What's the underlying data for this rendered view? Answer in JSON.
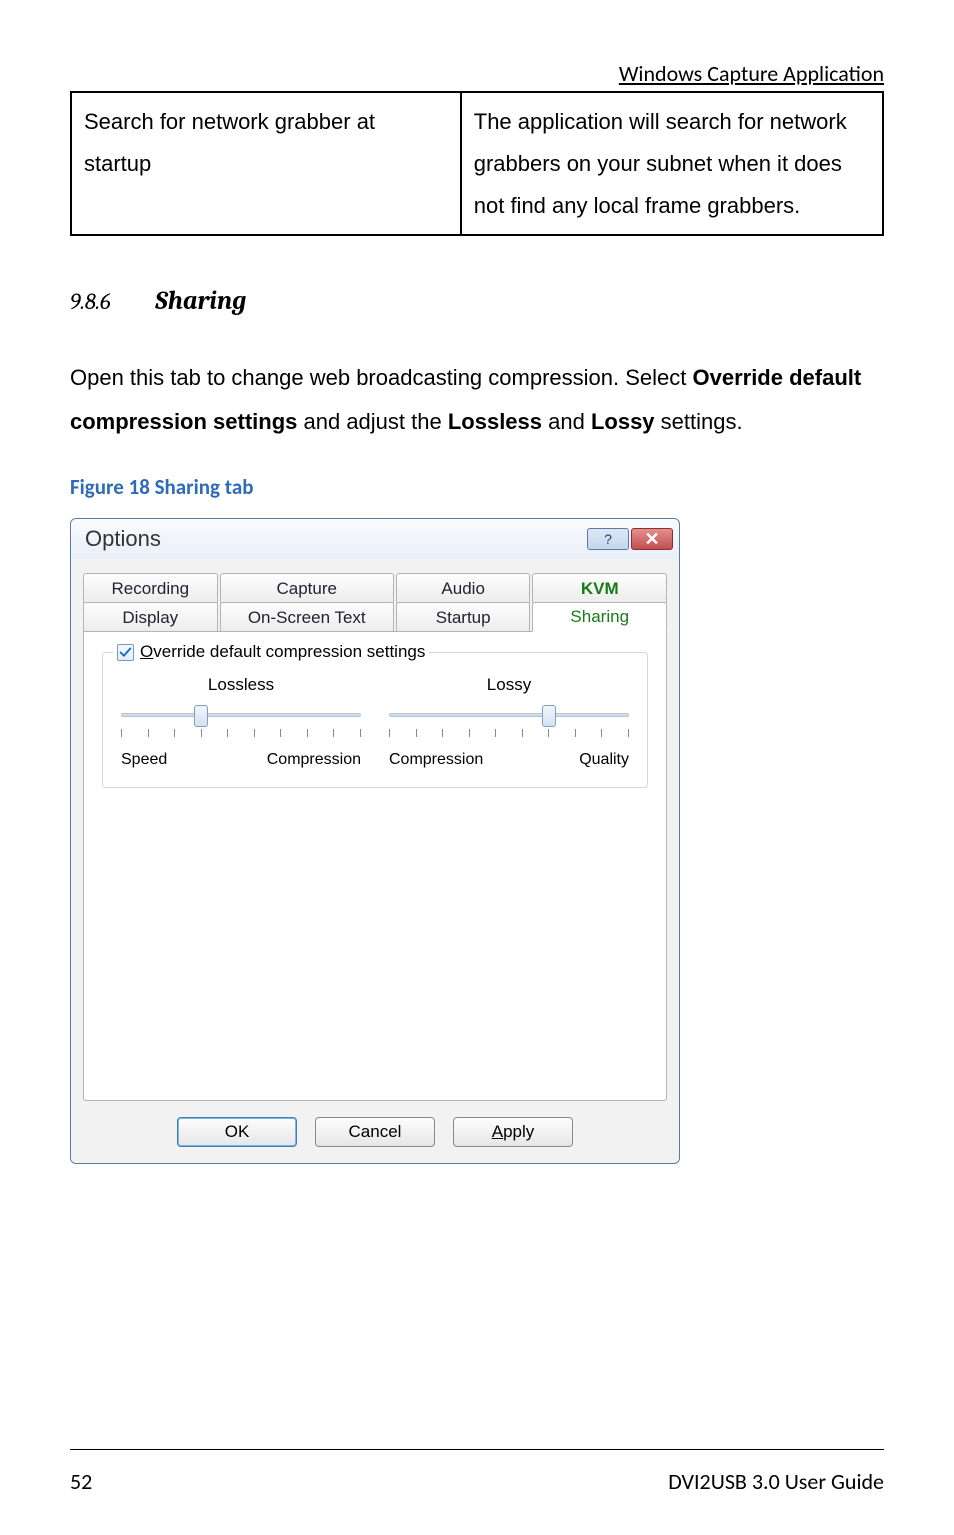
{
  "header": {
    "text": "Windows Capture Application"
  },
  "table": {
    "cell_left": "Search for network grabber at startup",
    "cell_right": "The application will search for network grabbers on your subnet when it does not find any local frame grabbers."
  },
  "section": {
    "number": "9.8.6",
    "title": "Sharing"
  },
  "paragraph": {
    "part1": "Open this tab to change web broadcasting compression. Select ",
    "bold1": "Override default compression settings",
    "part2": " and adjust the ",
    "bold2": "Lossless",
    "part3": " and ",
    "bold3": "Lossy",
    "part4": " settings."
  },
  "figure_caption": "Figure 18 Sharing tab",
  "dialog": {
    "title": "Options",
    "help_symbol": "?",
    "close_symbol": "✕",
    "tabs_row1": [
      "Recording",
      "Capture",
      "Audio",
      "KVM"
    ],
    "tabs_row2": [
      "Display",
      "On-Screen Text",
      "Startup",
      "Sharing"
    ],
    "active_tab": "Sharing",
    "checkbox_letter": "O",
    "checkbox_rest": "verride default compression settings",
    "lossless": {
      "title": "Lossless",
      "left": "Speed",
      "right": "Compression",
      "value": 3,
      "ticks": 10
    },
    "lossy": {
      "title": "Lossy",
      "left": "Compression",
      "right": "Quality",
      "value": 6,
      "ticks": 10
    },
    "buttons": {
      "ok": "OK",
      "cancel": "Cancel",
      "apply_letter": "A",
      "apply_rest": "pply"
    }
  },
  "footer": {
    "page": "52",
    "guide": "DVI2USB 3.0  User Guide"
  }
}
